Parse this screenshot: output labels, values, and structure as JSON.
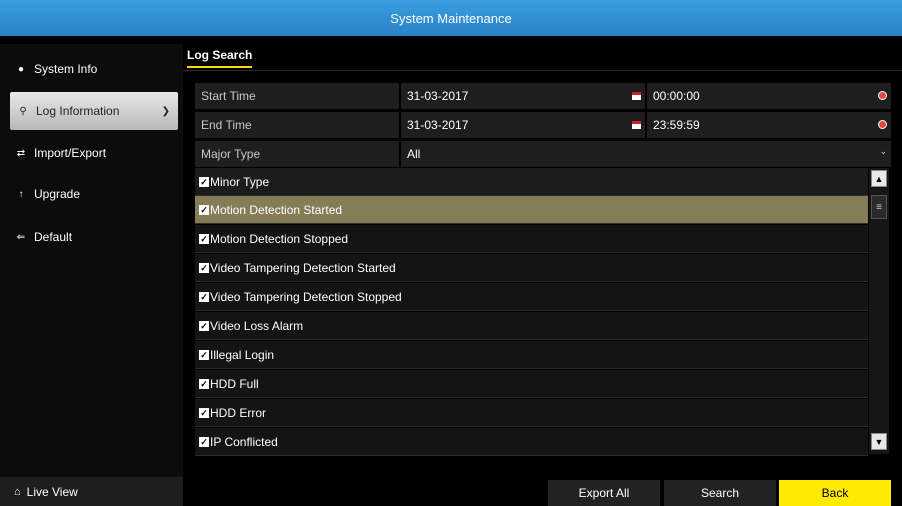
{
  "window": {
    "title": "System Maintenance"
  },
  "sidebar": {
    "items": [
      {
        "label": "System Info",
        "icon": "info-icon"
      },
      {
        "label": "Log Information",
        "icon": "search-icon",
        "active": true
      },
      {
        "label": "Import/Export",
        "icon": "import-export-icon"
      },
      {
        "label": "Upgrade",
        "icon": "upload-arrow-icon"
      },
      {
        "label": "Default",
        "icon": "default-icon"
      }
    ],
    "live_view": "Live View"
  },
  "tab": {
    "label": "Log Search"
  },
  "form": {
    "start_time_label": "Start Time",
    "start_date": "31-03-2017",
    "start_time": "00:00:00",
    "end_time_label": "End Time",
    "end_date": "31-03-2017",
    "end_time": "23:59:59",
    "major_type_label": "Major Type",
    "major_type_value": "All"
  },
  "minor_type": {
    "header": "Minor Type",
    "items": [
      "Motion Detection Started",
      "Motion Detection Stopped",
      "Video Tampering Detection Started",
      "Video Tampering Detection Stopped",
      "Video Loss Alarm",
      "Illegal Login",
      "HDD Full",
      "HDD Error",
      "IP Conflicted"
    ],
    "selected_index": 0
  },
  "buttons": {
    "export_all": "Export All",
    "search": "Search",
    "back": "Back"
  },
  "colors": {
    "title_bar": "#2a82c4",
    "accent": "#ffea00",
    "selected_row": "#857c58"
  }
}
